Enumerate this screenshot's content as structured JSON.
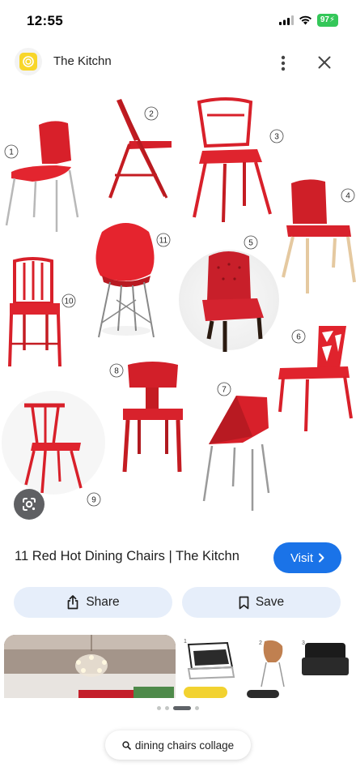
{
  "status_bar": {
    "time": "12:55",
    "battery": "97"
  },
  "header": {
    "site_name": "The Kitchn",
    "logo_icon": "kitchn-logo-icon",
    "more_icon": "more-vert-icon",
    "close_icon": "close-icon"
  },
  "image": {
    "chair_numbers": [
      "1",
      "2",
      "3",
      "4",
      "5",
      "6",
      "7",
      "8",
      "9",
      "10",
      "11"
    ],
    "lens_icon": "google-lens-icon"
  },
  "caption": {
    "title": "11 Red Hot Dining Chairs | The Kitchn",
    "visit_label": "Visit",
    "visit_color": "#1a73e8"
  },
  "actions": {
    "share_label": "Share",
    "save_label": "Save"
  },
  "related": {
    "thumb_left_numbers": [],
    "thumb_right_numbers": [
      "1",
      "2",
      "3"
    ]
  },
  "search_chip": {
    "label": "dining chairs collage",
    "icon": "search-icon"
  }
}
